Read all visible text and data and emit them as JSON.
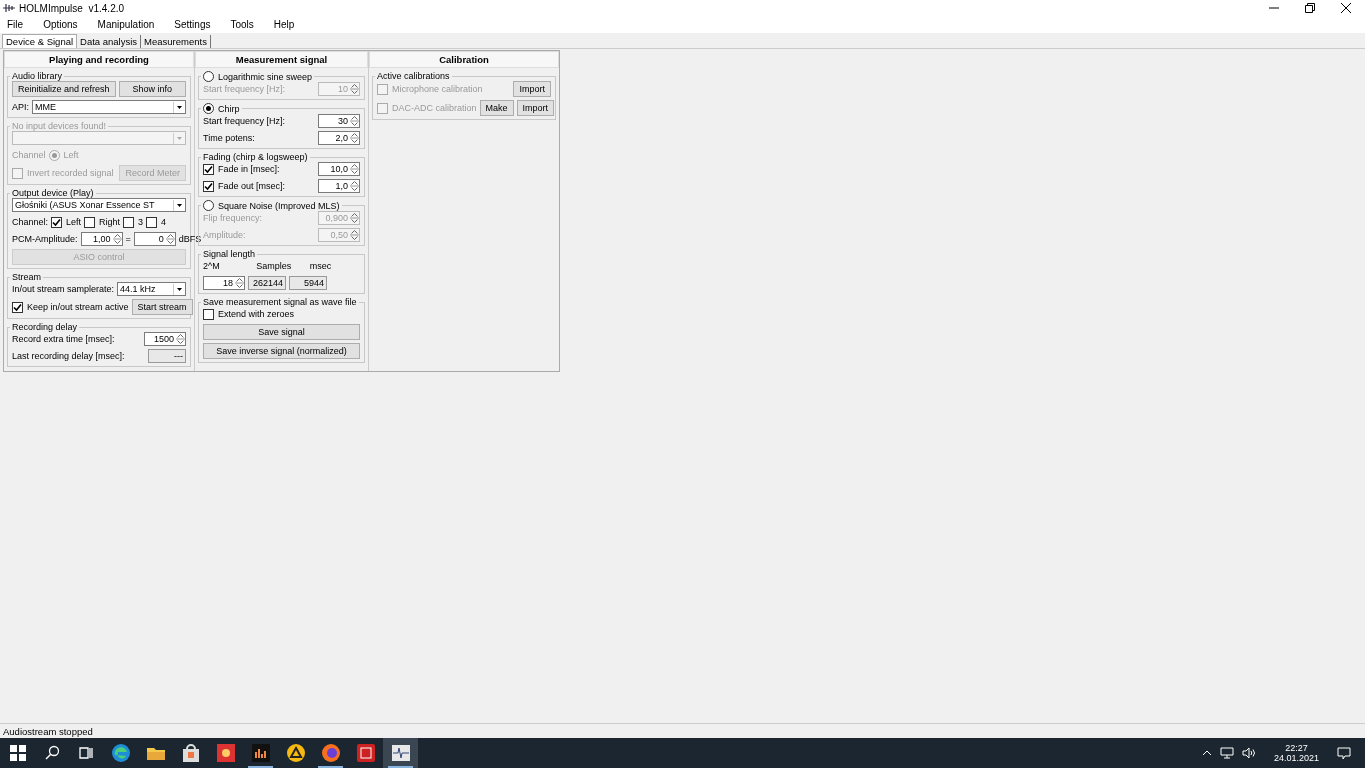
{
  "window": {
    "title": "HOLMImpulse  v1.4.2.0"
  },
  "menu": [
    "File",
    "Options",
    "Manipulation",
    "Settings",
    "Tools",
    "Help"
  ],
  "tabs": [
    {
      "label": "Device & Signal",
      "selected": true
    },
    {
      "label": "Data analysis",
      "selected": false
    },
    {
      "label": "Measurements",
      "selected": false
    }
  ],
  "panels": [
    {
      "title": "Playing and recording",
      "groups": [
        {
          "title": "Audio library",
          "disabled": false,
          "rows": [
            {
              "items": [
                {
                  "kind": "button",
                  "label": "Reinitialize and refresh",
                  "disabled": false
                },
                {
                  "kind": "button",
                  "label": "Show info",
                  "disabled": false
                }
              ]
            },
            {
              "items": [
                {
                  "kind": "label",
                  "text": "API:",
                  "disabled": false
                },
                {
                  "kind": "select",
                  "value": "MME",
                  "disabled": false
                }
              ]
            }
          ]
        },
        {
          "title": "No input devices found!",
          "disabled": true,
          "rows": [
            {
              "items": [
                {
                  "kind": "select",
                  "disabled": true
                }
              ]
            },
            {
              "items": [
                {
                  "kind": "label",
                  "text": "Channel",
                  "disabled": true
                },
                {
                  "kind": "radio",
                  "label": "Left",
                  "checked": true,
                  "disabled": true
                }
              ]
            },
            {
              "items": [
                {
                  "kind": "check",
                  "label": "Invert recorded signal",
                  "checked": false,
                  "disabled": true
                },
                {
                  "kind": "button",
                  "label": "Record Meter",
                  "disabled": true
                }
              ]
            }
          ]
        },
        {
          "title": "Output device (Play)",
          "disabled": false,
          "rows": [
            {
              "items": [
                {
                  "kind": "select",
                  "value": "Głośniki (ASUS Xonar Essence ST",
                  "disabled": false
                }
              ]
            },
            {
              "items": [
                {
                  "kind": "label",
                  "text": "Channel:",
                  "disabled": false
                },
                {
                  "kind": "check",
                  "label": "Left",
                  "checked": true,
                  "disabled": false
                },
                {
                  "kind": "check",
                  "label": "Right",
                  "checked": false,
                  "disabled": false
                },
                {
                  "kind": "check",
                  "label": "3",
                  "checked": false,
                  "disabled": false
                },
                {
                  "kind": "check",
                  "label": "4",
                  "checked": false,
                  "disabled": false
                }
              ]
            },
            {
              "items": [
                {
                  "kind": "label",
                  "text": "PCM-Amplitude:",
                  "disabled": false
                },
                {
                  "kind": "spin",
                  "value": "1,00",
                  "disabled": false
                },
                {
                  "kind": "label",
                  "text": "=",
                  "disabled": false
                },
                {
                  "kind": "spin",
                  "value": "0",
                  "disabled": false
                },
                {
                  "kind": "label",
                  "text": "dBFS",
                  "disabled": false
                }
              ]
            },
            {
              "items": [
                {
                  "kind": "button",
                  "label": "ASIO control",
                  "disabled": true
                }
              ]
            }
          ]
        },
        {
          "title": "Stream",
          "disabled": false,
          "rows": [
            {
              "items": [
                {
                  "kind": "label",
                  "text": "In/out stream samplerate:",
                  "disabled": false
                },
                {
                  "kind": "select",
                  "value": "44.1 kHz",
                  "disabled": false
                }
              ]
            },
            {
              "items": [
                {
                  "kind": "check",
                  "label": "Keep in/out stream active",
                  "checked": true,
                  "disabled": false
                },
                {
                  "kind": "button",
                  "label": "Start stream",
                  "disabled": false
                }
              ]
            }
          ]
        },
        {
          "title": "Recording delay",
          "disabled": false,
          "rows": [
            {
              "items": [
                {
                  "kind": "label",
                  "text": "Record extra time [msec]:",
                  "disabled": false
                },
                {
                  "kind": "spin",
                  "value": "1500",
                  "disabled": false
                }
              ]
            },
            {
              "items": [
                {
                  "kind": "label",
                  "text": "Last recording delay [msec]:",
                  "disabled": false
                },
                {
                  "kind": "readonly",
                  "value": "---"
                }
              ]
            }
          ]
        }
      ]
    },
    {
      "title": "Measurement signal",
      "groups": [
        {
          "title": "Logarithmic sine sweep",
          "selected": false,
          "disabled": false,
          "rows": [
            {
              "items": [
                {
                  "kind": "label",
                  "text": "Start frequency [Hz]:",
                  "disabled": true
                },
                {
                  "kind": "spin",
                  "value": "10",
                  "disabled": true
                }
              ]
            }
          ]
        },
        {
          "title": "Chirp",
          "selected": true,
          "disabled": false,
          "rows": [
            {
              "items": [
                {
                  "kind": "label",
                  "text": "Start frequency [Hz]:",
                  "disabled": false
                },
                {
                  "kind": "spin",
                  "value": "30",
                  "disabled": false
                }
              ]
            },
            {
              "items": [
                {
                  "kind": "label",
                  "text": "Time potens:",
                  "disabled": false
                },
                {
                  "kind": "spin",
                  "value": "2,0",
                  "disabled": false
                }
              ]
            }
          ]
        },
        {
          "title": "Fading (chirp & logsweep)",
          "disabled": false,
          "rows": [
            {
              "items": [
                {
                  "kind": "check",
                  "label": "Fade in [msec]:",
                  "checked": true,
                  "disabled": false
                },
                {
                  "kind": "spin",
                  "value": "10,0",
                  "disabled": false
                }
              ]
            },
            {
              "items": [
                {
                  "kind": "check",
                  "label": "Fade out [msec]:",
                  "checked": true,
                  "disabled": false
                },
                {
                  "kind": "spin",
                  "value": "1,0",
                  "disabled": false
                }
              ]
            }
          ]
        },
        {
          "title": "Square Noise (Improved MLS)",
          "selected": false,
          "disabled": false,
          "rows": [
            {
              "items": [
                {
                  "kind": "label",
                  "text": "Flip frequency:",
                  "disabled": true
                },
                {
                  "kind": "spin",
                  "value": "0,900",
                  "disabled": true
                }
              ]
            },
            {
              "items": [
                {
                  "kind": "label",
                  "text": "Amplitude:",
                  "disabled": true
                },
                {
                  "kind": "spin",
                  "value": "0,50",
                  "disabled": true
                }
              ]
            }
          ]
        },
        {
          "title": "Signal length",
          "disabled": false,
          "grid": true,
          "rows": [
            {
              "items": [
                {
                  "kind": "label",
                  "text": "2^M",
                  "disabled": false
                },
                {
                  "kind": "label",
                  "text": "Samples",
                  "disabled": false
                },
                {
                  "kind": "label",
                  "text": "msec",
                  "disabled": false
                }
              ]
            },
            {
              "items": [
                {
                  "kind": "spin",
                  "value": "18",
                  "disabled": false
                },
                {
                  "kind": "readonly",
                  "value": "262144"
                },
                {
                  "kind": "readonly",
                  "value": "5944"
                }
              ]
            }
          ]
        },
        {
          "title": "Save measurement signal as wave file",
          "disabled": false,
          "rows": [
            {
              "items": [
                {
                  "kind": "check",
                  "label": "Extend with zeroes",
                  "checked": false,
                  "disabled": false
                }
              ]
            },
            {
              "items": [
                {
                  "kind": "button",
                  "label": "Save signal",
                  "disabled": false
                }
              ]
            },
            {
              "items": [
                {
                  "kind": "button",
                  "label": "Save inverse signal (normalized)",
                  "disabled": false
                }
              ]
            }
          ]
        }
      ]
    },
    {
      "title": "Calibration",
      "groups": [
        {
          "title": "Active calibrations",
          "disabled": false,
          "rows": [
            {
              "items": [
                {
                  "kind": "check",
                  "label": "Microphone calibration",
                  "checked": false,
                  "disabled": true
                },
                {
                  "kind": "button",
                  "label": "Import",
                  "disabled": false
                }
              ]
            },
            {
              "items": [
                {
                  "kind": "check",
                  "label": "DAC-ADC calibration",
                  "checked": false,
                  "disabled": true
                },
                {
                  "kind": "button",
                  "label": "Make",
                  "disabled": false
                },
                {
                  "kind": "button",
                  "label": "Import",
                  "disabled": false
                }
              ]
            }
          ]
        }
      ]
    }
  ],
  "status_bar": "Audiostream stopped",
  "taskbar": {
    "apps": [
      {
        "kind": "browser",
        "running": false,
        "selected": false
      },
      {
        "kind": "folder",
        "running": false,
        "selected": false
      },
      {
        "kind": "bag",
        "running": false,
        "selected": false
      },
      {
        "kind": "redtile",
        "running": false,
        "selected": false
      },
      {
        "kind": "bars",
        "running": true,
        "selected": false
      },
      {
        "kind": "triangle",
        "running": false,
        "selected": false
      },
      {
        "kind": "fox",
        "running": true,
        "selected": false
      },
      {
        "kind": "redbox",
        "running": false,
        "selected": false
      },
      {
        "kind": "wave",
        "running": true,
        "selected": true
      }
    ],
    "time": "22:27",
    "date": "24.01.2021"
  }
}
